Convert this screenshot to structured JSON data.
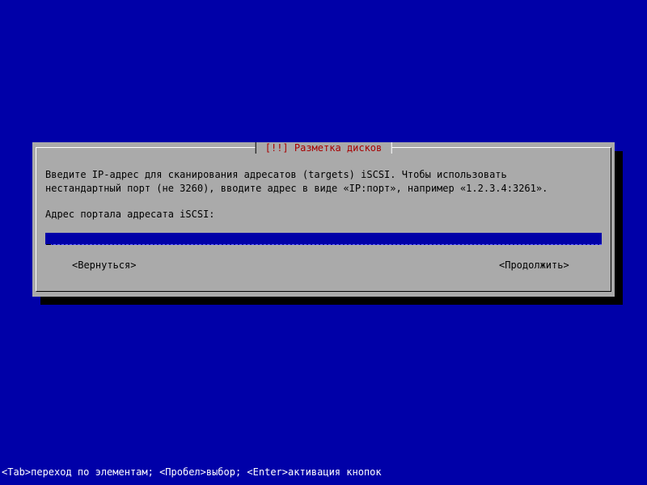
{
  "dialog": {
    "title": "[!!] Разметка дисков",
    "description_lines": [
      "Введите IP-адрес для сканирования адресатов (targets) iSCSI. Чтобы использовать",
      "нестандартный порт (не 3260), вводите адрес в виде «IP:порт», например «1.2.3.4:3261»."
    ],
    "field_label": "Адрес портала адресата iSCSI:",
    "input": {
      "value": "",
      "placeholder": ""
    },
    "buttons": {
      "back_label": "<Вернуться>",
      "continue_label": "<Продолжить>"
    }
  },
  "status_bar": {
    "text": "<Tab>переход по элементам; <Пробел>выбор; <Enter>активация кнопок"
  },
  "colors": {
    "background": "#0000a8",
    "dialog": "#aaaaaa",
    "title": "#a80000",
    "input_bg": "#0000a8",
    "text": "#000000",
    "status_text": "#ffffff"
  }
}
